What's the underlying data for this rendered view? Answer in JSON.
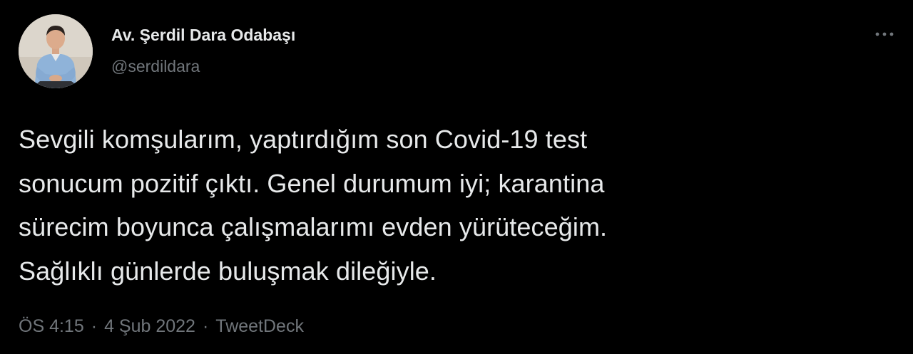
{
  "author": {
    "display_name": "Av. Şerdil Dara Odabaşı",
    "handle": "@serdildara"
  },
  "more_icon": "more-horizontal-icon",
  "tweet": {
    "lines": [
      "Sevgili komşularım, yaptırdığım son Covid-19 test",
      "sonucum pozitif çıktı. Genel durumum iyi; karantina",
      "sürecim boyunca çalışmalarımı evden yürüteceğim.",
      "Sağlıklı günlerde buluşmak dileğiyle."
    ]
  },
  "meta": {
    "time": "ÖS 4:15",
    "separator": "·",
    "date": "4 Şub 2022",
    "source": "TweetDeck"
  },
  "colors": {
    "background": "#000000",
    "primary_text": "#e7e9ea",
    "secondary_text": "#71767b"
  }
}
